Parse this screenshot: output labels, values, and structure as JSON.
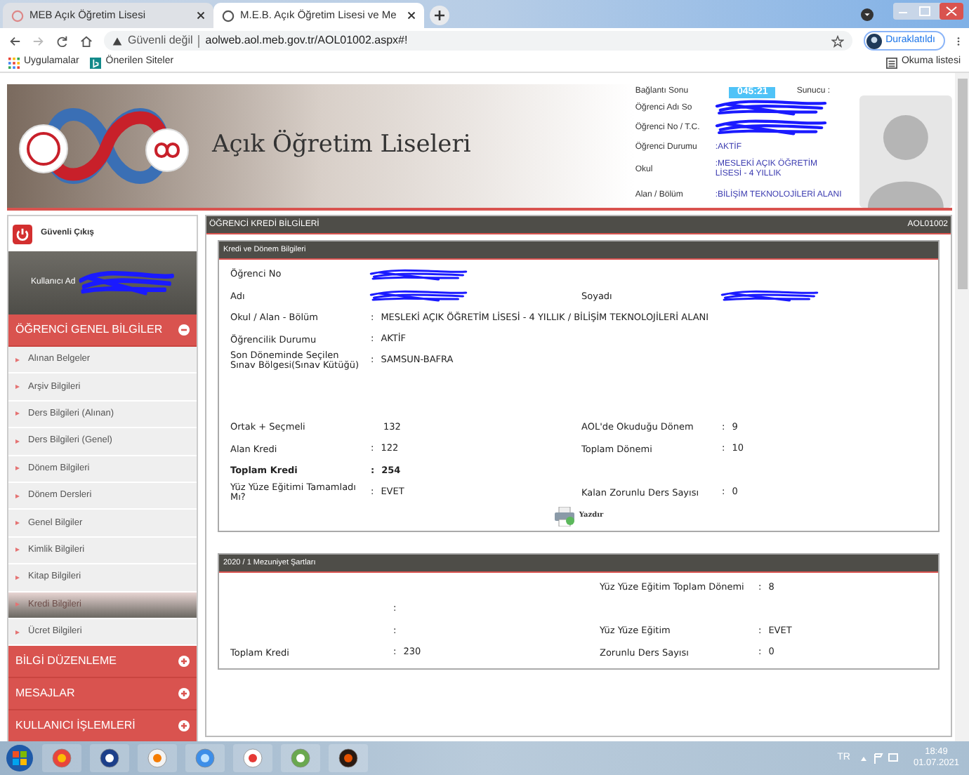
{
  "browser": {
    "tabs": [
      {
        "title": "MEB Açık Öğretim Lisesi",
        "selected": false
      },
      {
        "title": "M.E.B. Açık Öğretim Lisesi ve Me",
        "selected": true
      }
    ],
    "security": "Güvenli değil",
    "url": "aolweb.aol.meb.gov.tr/AOL01002.aspx#!",
    "profile": "Duraklatıldı",
    "bookmarks": [
      "Uygulamalar",
      "Önerilen Siteler"
    ],
    "reading_list": "Okuma listesi"
  },
  "header": {
    "site_title": "Açık Öğretim Liseleri",
    "session": {
      "label": "Bağlantı Sonu",
      "value": "045:21",
      "server_label": "Sunucu :"
    },
    "info": [
      {
        "label": "Öğrenci Adı So",
        "redacted": true
      },
      {
        "label": "Öğrenci No / T.C.",
        "redacted": true
      },
      {
        "label": "Öğrenci Durumu",
        "value": ":AKTİF"
      },
      {
        "label": "Okul",
        "value": ":MESLEKİ AÇIK ÖĞRETİM LİSESİ - 4 YILLIK"
      },
      {
        "label": "Alan / Bölüm",
        "value": ":BİLİŞİM TEKNOLOJİLERİ ALANI"
      }
    ]
  },
  "sidebar": {
    "logout": "Güvenli Çıkış",
    "user_label": "Kullanıcı Ad",
    "user_redacted": true,
    "sections": [
      {
        "title": "ÖĞRENCİ GENEL BİLGİLER",
        "expanded": true,
        "items": [
          {
            "label": "Alınan Belgeler",
            "selected": false
          },
          {
            "label": "Arşiv Bilgileri",
            "selected": false
          },
          {
            "label": "Ders Bilgileri (Alınan)",
            "selected": false
          },
          {
            "label": "Ders Bilgileri (Genel)",
            "selected": false
          },
          {
            "label": "Dönem Bilgileri",
            "selected": false
          },
          {
            "label": "Dönem Dersleri",
            "selected": false
          },
          {
            "label": "Genel Bilgiler",
            "selected": false
          },
          {
            "label": "Kimlik Bilgileri",
            "selected": false
          },
          {
            "label": "Kitap Bilgileri",
            "selected": false
          },
          {
            "label": "Kredi Bilgileri",
            "selected": true
          },
          {
            "label": "Ücret Bilgileri",
            "selected": false
          }
        ]
      },
      {
        "title": "BİLGİ DÜZENLEME",
        "expanded": false
      },
      {
        "title": "MESAJLAR",
        "expanded": false
      },
      {
        "title": "KULLANICI İŞLEMLERİ",
        "expanded": false
      }
    ]
  },
  "main": {
    "title": "ÖĞRENCİ KREDİ BİLGİLERİ",
    "code": "AOL01002",
    "sections": [
      {
        "title": "Kredi ve Dönem Bilgileri",
        "rows": [
          {
            "left": {
              "label": "Öğrenci No",
              "redacted": true
            }
          },
          {
            "left": {
              "label": "Adı",
              "redacted": true
            },
            "right": {
              "label": "Soyadı",
              "redacted": true
            }
          },
          {
            "left": {
              "label": "Okul / Alan - Bölüm",
              "colon": ":",
              "value": "MESLEKİ AÇIK ÖĞRETİM LİSESİ - 4 YILLIK / BİLİŞİM TEKNOLOJİLERİ ALANI"
            }
          },
          {
            "left": {
              "label": "Öğrencilik Durumu",
              "colon": ":",
              "value": "AKTİF"
            }
          },
          {
            "left": {
              "label": "Son Döneminde Seçilen Sınav Bölgesi(Sınav Kütüğü)",
              "colon": ":",
              "value": "SAMSUN-BAFRA"
            },
            "gap_after": true
          },
          {
            "left": {
              "label": "Ortak + Seçmeli",
              "value": "132"
            },
            "right": {
              "label": "AOL'de Okuduğu Dönem",
              "colon": ":",
              "value": "9"
            }
          },
          {
            "left": {
              "label": "Alan Kredi",
              "colon": ":",
              "value": "122"
            },
            "right": {
              "label": "Toplam Dönemi",
              "colon": ":",
              "value": "10"
            }
          },
          {
            "left": {
              "label": "Toplam Kredi",
              "colon": ":",
              "value": "254",
              "bold": true
            }
          },
          {
            "left": {
              "label": "Yüz Yüze Eğitimi Tamamladı Mı?",
              "colon": ":",
              "value": "EVET"
            },
            "right": {
              "label": "Kalan Zorunlu Ders Sayısı",
              "colon": ":",
              "value": "0"
            }
          }
        ],
        "print": "Yazdır"
      },
      {
        "title": "2020 / 1 Mezuniyet Şartları",
        "rows": [
          {
            "right": {
              "label": "Yüz Yüze Eğitim Toplam Dönemi",
              "colon": ":",
              "value": "8"
            }
          },
          {
            "left": {
              "colon": ":"
            }
          },
          {
            "left": {
              "colon": ":"
            },
            "right": {
              "label": "Yüz Yüze Eğitim",
              "colon": ":",
              "value": "EVET"
            }
          },
          {
            "left": {
              "label": "Toplam Kredi",
              "colon": ":",
              "value": "230"
            },
            "right": {
              "label": "Zorunlu Ders Sayısı",
              "colon": ":",
              "value": "0"
            }
          }
        ]
      }
    ]
  },
  "taskbar": {
    "language": "TR",
    "time": "18:49",
    "date": "01.07.2021"
  }
}
